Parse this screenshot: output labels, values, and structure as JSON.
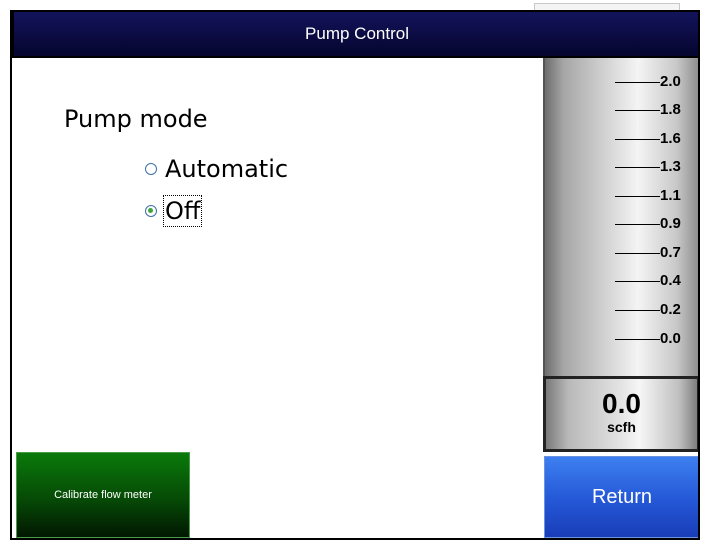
{
  "window": {
    "title": "Pump Control"
  },
  "pump_mode": {
    "label": "Pump mode",
    "options": [
      {
        "label": "Automatic",
        "selected": false
      },
      {
        "label": "Off",
        "selected": true
      }
    ]
  },
  "flow_gauge": {
    "ticks": [
      "2.0",
      "1.8",
      "1.6",
      "1.3",
      "1.1",
      "0.9",
      "0.7",
      "0.4",
      "0.2",
      "0.0"
    ],
    "value": "0.0",
    "unit": "scfh"
  },
  "buttons": {
    "calibrate": "Calibrate flow meter",
    "return": "Return"
  },
  "colors": {
    "title_bar": "#05052e",
    "calibrate_button": "#064a06",
    "return_button": "#2457d6",
    "radio_selected": "#3da53d"
  }
}
